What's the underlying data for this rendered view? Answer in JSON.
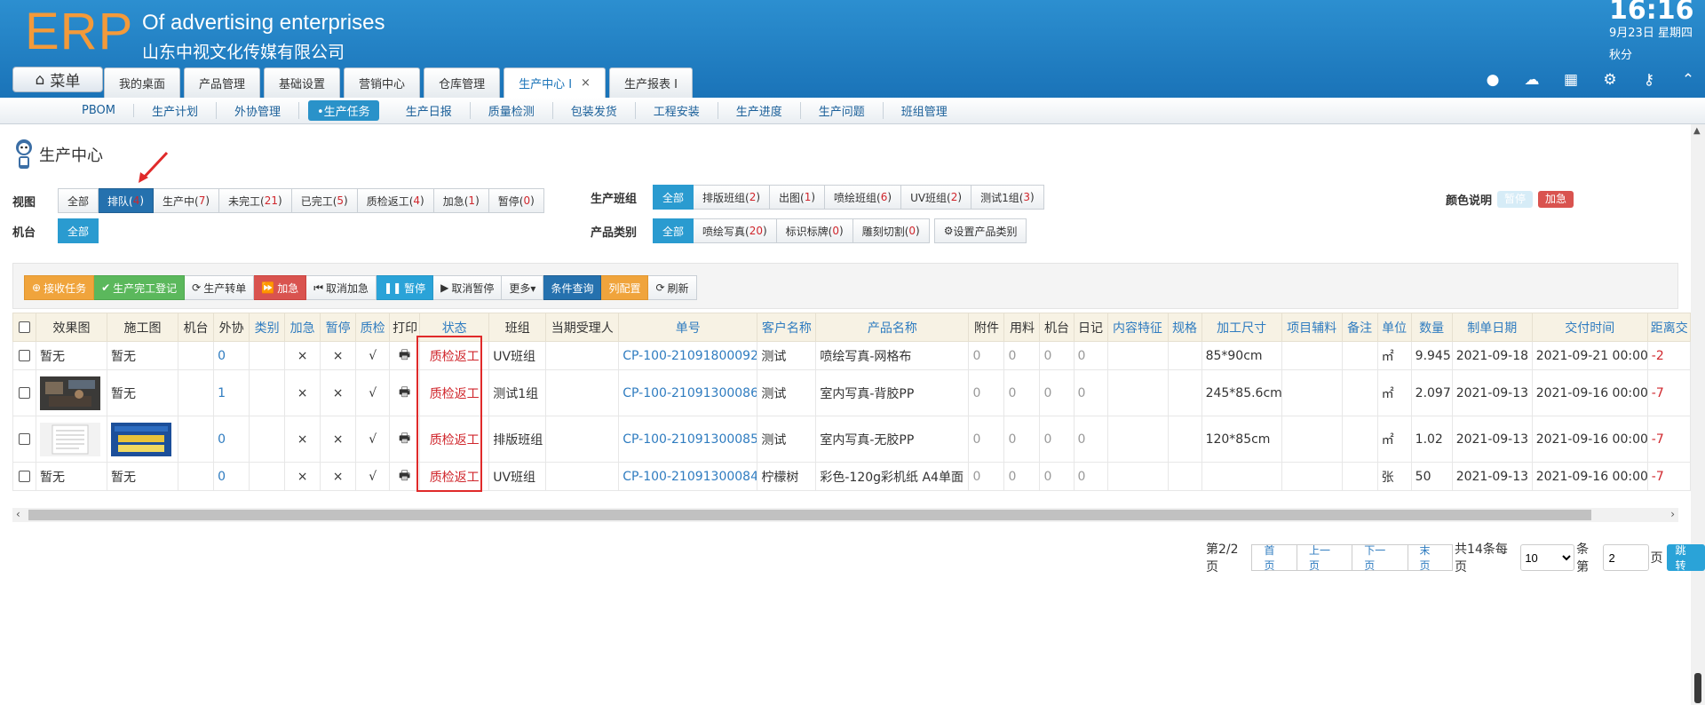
{
  "header": {
    "logo": "ERP",
    "title_en": "Of advertising enterprises",
    "company": "山东中视文化传媒有限公司",
    "time": "16:16",
    "date": "9月23日 星期四",
    "user": "秋分",
    "menu_label": "菜单"
  },
  "tabs": [
    {
      "label": "我的桌面"
    },
    {
      "label": "产品管理"
    },
    {
      "label": "基础设置"
    },
    {
      "label": "营销中心"
    },
    {
      "label": "仓库管理"
    },
    {
      "label": "生产中心 I",
      "close": "×"
    },
    {
      "label": "生产报表 I"
    }
  ],
  "subnav": [
    "PBOM",
    "生产计划",
    "外协管理",
    "•生产任务",
    "生产日报",
    "质量检测",
    "包装发货",
    "工程安装",
    "生产进度",
    "生产问题",
    "班组管理"
  ],
  "page_title": "生产中心",
  "filters": {
    "view_label": "视图",
    "views": [
      {
        "text": "全部"
      },
      {
        "text": "排队(",
        "count": "4",
        "end": ")"
      },
      {
        "text": "生产中(",
        "count": "7",
        "end": ")"
      },
      {
        "text": "未完工(",
        "count": "21",
        "end": ")"
      },
      {
        "text": "已完工(",
        "count": "5",
        "end": ")"
      },
      {
        "text": "质检返工(",
        "count": "4",
        "end": ")"
      },
      {
        "text": "加急(",
        "count": "1",
        "end": ")"
      },
      {
        "text": "暂停(",
        "count": "0",
        "end": ")"
      }
    ],
    "machine_label": "机台",
    "machine_all": "全部",
    "team_label": "生产班组",
    "teams": [
      {
        "text": "全部"
      },
      {
        "text": "排版班组(",
        "count": "2",
        "end": ")"
      },
      {
        "text": "出图(",
        "count": "1",
        "end": ")"
      },
      {
        "text": "喷绘班组(",
        "count": "6",
        "end": ")"
      },
      {
        "text": "UV班组(",
        "count": "2",
        "end": ")"
      },
      {
        "text": "测试1组(",
        "count": "3",
        "end": ")"
      }
    ],
    "category_label": "产品类别",
    "categories": [
      {
        "text": "全部"
      },
      {
        "text": "喷绘写真(",
        "count": "20",
        "end": ")"
      },
      {
        "text": "标识标牌(",
        "count": "0",
        "end": ")"
      },
      {
        "text": "雕刻切割(",
        "count": "0",
        "end": ")"
      }
    ],
    "set_category": "设置产品类别",
    "color_label": "颜色说明",
    "color_pause": "暂停",
    "color_urgent": "加急"
  },
  "toolbar": [
    "接收任务",
    "生产完工登记",
    "生产转单",
    "加急",
    "取消加急",
    "暂停",
    "取消暂停",
    "更多▾",
    "条件查询",
    "列配置",
    "刷新"
  ],
  "table": {
    "headers": [
      "效果图",
      "施工图",
      "机台",
      "外协",
      "类别",
      "加急",
      "暂停",
      "质检",
      "打印",
      "状态",
      "班组",
      "当期受理人",
      "单号",
      "客户名称",
      "产品名称",
      "附件",
      "用料",
      "机台",
      "日记",
      "内容特征",
      "规格",
      "加工尺寸",
      "项目辅料",
      "备注",
      "单位",
      "数量",
      "制单日期",
      "交付时间",
      "距离交"
    ],
    "rows": [
      {
        "effect": "暂无",
        "construct": "暂无",
        "waixie": "0",
        "urgent": "×",
        "pause": "×",
        "qc": "√",
        "status": "质检返工",
        "team": "UV班组",
        "order": "CP-100-21091800092",
        "customer": "测试",
        "product": "喷绘写真-网格布",
        "att": "0",
        "mat": "0",
        "mach": "0",
        "log": "0",
        "size": "85*90cm",
        "unit": "㎡",
        "qty": "9.945",
        "created": "2021-09-18",
        "deliver": "2021-09-21 00:00",
        "dist": "-2"
      },
      {
        "effect": "",
        "construct": "暂无",
        "waixie": "1",
        "urgent": "×",
        "pause": "×",
        "qc": "√",
        "status": "质检返工",
        "team": "测试1组",
        "order": "CP-100-21091300086",
        "customer": "测试",
        "product": "室内写真-背胶PP",
        "att": "0",
        "mat": "0",
        "mach": "0",
        "log": "0",
        "size": "245*85.6cm",
        "unit": "㎡",
        "qty": "2.097",
        "created": "2021-09-13",
        "deliver": "2021-09-16 00:00",
        "dist": "-7"
      },
      {
        "effect": "",
        "construct": "",
        "waixie": "0",
        "urgent": "×",
        "pause": "×",
        "qc": "√",
        "status": "质检返工",
        "team": "排版班组",
        "order": "CP-100-21091300085",
        "customer": "测试",
        "product": "室内写真-无胶PP",
        "att": "0",
        "mat": "0",
        "mach": "0",
        "log": "0",
        "size": "120*85cm",
        "unit": "㎡",
        "qty": "1.02",
        "created": "2021-09-13",
        "deliver": "2021-09-16 00:00",
        "dist": "-7"
      },
      {
        "effect": "暂无",
        "construct": "暂无",
        "waixie": "0",
        "urgent": "×",
        "pause": "×",
        "qc": "√",
        "status": "质检返工",
        "team": "UV班组",
        "order": "CP-100-21091300084",
        "customer": "柠檬树",
        "product": "彩色-120g彩机纸 A4单面",
        "att": "0",
        "mat": "0",
        "mach": "0",
        "log": "0",
        "size": "",
        "unit": "张",
        "qty": "50",
        "created": "2021-09-13",
        "deliver": "2021-09-16 00:00",
        "dist": "-7"
      }
    ]
  },
  "pager": {
    "page_info": "第2/2页",
    "first": "首页",
    "prev": "上一页",
    "next": "下一页",
    "last": "末页",
    "total": "共14条每页",
    "per_page": "10",
    "per_unit": "条第",
    "goto_value": "2",
    "page_unit": "页",
    "go": "跳转"
  },
  "colors": {
    "accent": "#2a9bd0",
    "header": "#1a73b8",
    "logo": "#f39a3a",
    "danger": "#d0262c"
  }
}
